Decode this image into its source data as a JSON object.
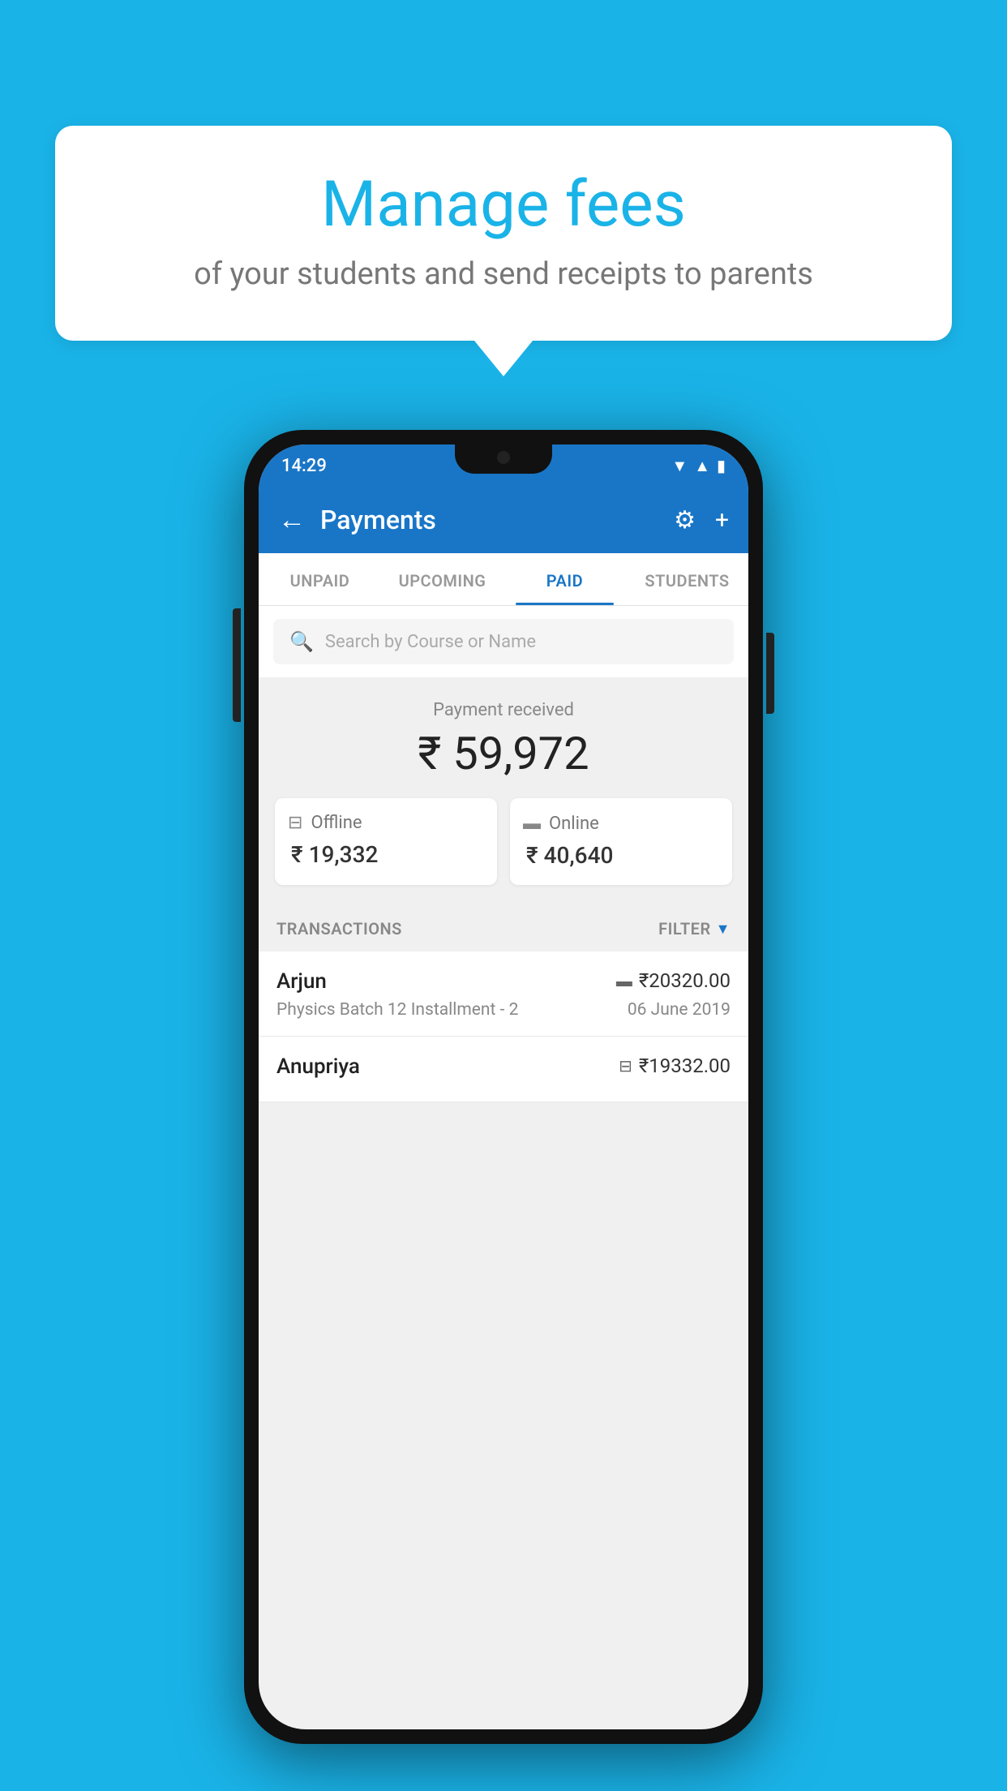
{
  "background_color": "#1ab3e8",
  "bubble": {
    "title": "Manage fees",
    "subtitle": "of your students and send receipts to parents"
  },
  "status_bar": {
    "time": "14:29"
  },
  "app_bar": {
    "title": "Payments",
    "back_label": "←",
    "gear_label": "⚙",
    "plus_label": "+"
  },
  "tabs": [
    {
      "label": "UNPAID",
      "active": false
    },
    {
      "label": "UPCOMING",
      "active": false
    },
    {
      "label": "PAID",
      "active": true
    },
    {
      "label": "STUDENTS",
      "active": false
    }
  ],
  "search": {
    "placeholder": "Search by Course or Name"
  },
  "payment": {
    "label": "Payment received",
    "amount": "₹ 59,972",
    "offline_label": "Offline",
    "offline_amount": "₹ 19,332",
    "online_label": "Online",
    "online_amount": "₹ 40,640"
  },
  "transactions": {
    "label": "TRANSACTIONS",
    "filter_label": "FILTER",
    "items": [
      {
        "name": "Arjun",
        "amount": "₹20320.00",
        "course": "Physics Batch 12 Installment - 2",
        "date": "06 June 2019",
        "payment_type": "online"
      },
      {
        "name": "Anupriya",
        "amount": "₹19332.00",
        "course": "",
        "date": "",
        "payment_type": "offline"
      }
    ]
  }
}
